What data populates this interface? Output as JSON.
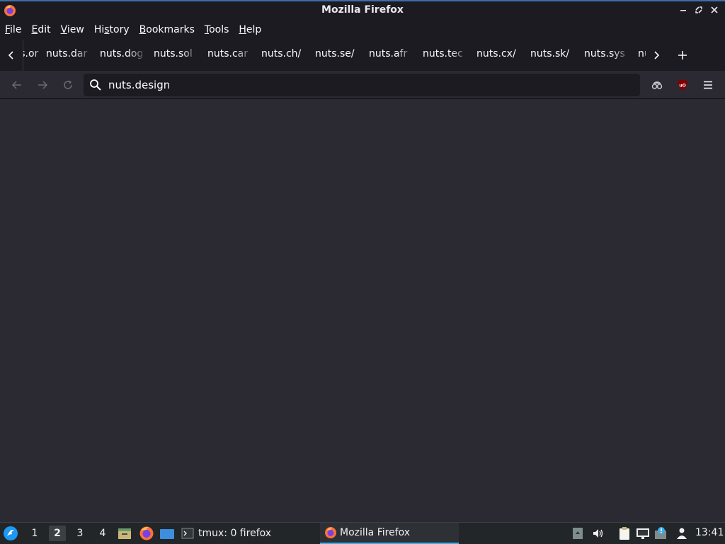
{
  "window": {
    "title": "Mozilla Firefox"
  },
  "menubar": {
    "items": [
      {
        "label": "File",
        "u": "F",
        "rest": "ile"
      },
      {
        "label": "Edit",
        "u": "E",
        "rest": "dit"
      },
      {
        "label": "View",
        "u": "V",
        "rest": "iew"
      },
      {
        "label": "History",
        "u": "",
        "pre": "Hi",
        "mid": "s",
        "post": "tory"
      },
      {
        "label": "Bookmarks",
        "u": "B",
        "rest": "ookmarks"
      },
      {
        "label": "Tools",
        "u": "T",
        "rest": "ools"
      },
      {
        "label": "Help",
        "u": "H",
        "rest": "elp"
      }
    ]
  },
  "tabs": [
    {
      "label": "nuts.or",
      "faded": true
    },
    {
      "label": "nuts.dar",
      "faded": true
    },
    {
      "label": "nuts.dog",
      "faded": true
    },
    {
      "label": "nuts.sol",
      "faded": true
    },
    {
      "label": "nuts.car",
      "faded": true
    },
    {
      "label": "nuts.ch/",
      "faded": false
    },
    {
      "label": "nuts.se/",
      "faded": false
    },
    {
      "label": "nuts.afr",
      "faded": true
    },
    {
      "label": "nuts.tec",
      "faded": true
    },
    {
      "label": "nuts.cx/",
      "faded": false
    },
    {
      "label": "nuts.sk/",
      "faded": false
    },
    {
      "label": "nuts.sys",
      "faded": true
    },
    {
      "label": "nu",
      "faded": true
    }
  ],
  "navbar": {
    "url": "nuts.design"
  },
  "taskbar": {
    "workspaces": [
      "1",
      "2",
      "3",
      "4"
    ],
    "active_workspace": "2",
    "tasks": [
      {
        "label": "tmux: 0 firefox",
        "active": false
      },
      {
        "label": "Mozilla Firefox",
        "active": true
      }
    ],
    "clock": "13:41"
  },
  "colors": {
    "accent": "#3daee9",
    "titlebar_border": "#3d6ea8",
    "ublock": "#800000"
  }
}
